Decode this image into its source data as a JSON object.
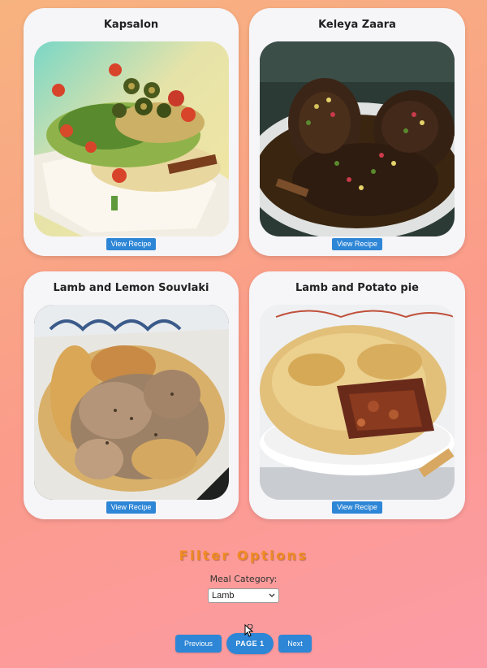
{
  "recipes": [
    {
      "title": "Kapsalon",
      "button": "View Recipe",
      "image": "kapsalon-photo"
    },
    {
      "title": "Keleya Zaara",
      "button": "View Recipe",
      "image": "keleya-zaara-photo"
    },
    {
      "title": "Lamb and Lemon Souvlaki",
      "button": "View Recipe",
      "image": "souvlaki-photo"
    },
    {
      "title": "Lamb and Potato pie",
      "button": "View Recipe",
      "image": "potato-pie-photo"
    }
  ],
  "filter": {
    "title": "Filter Options",
    "label": "Meal Category:",
    "selected": "Lamb"
  },
  "pagination": {
    "previous": "Previous",
    "current": "PAGE 1",
    "next": "Next"
  },
  "colors": {
    "accent": "#2d86d6",
    "filter_title": "#f08a22"
  }
}
